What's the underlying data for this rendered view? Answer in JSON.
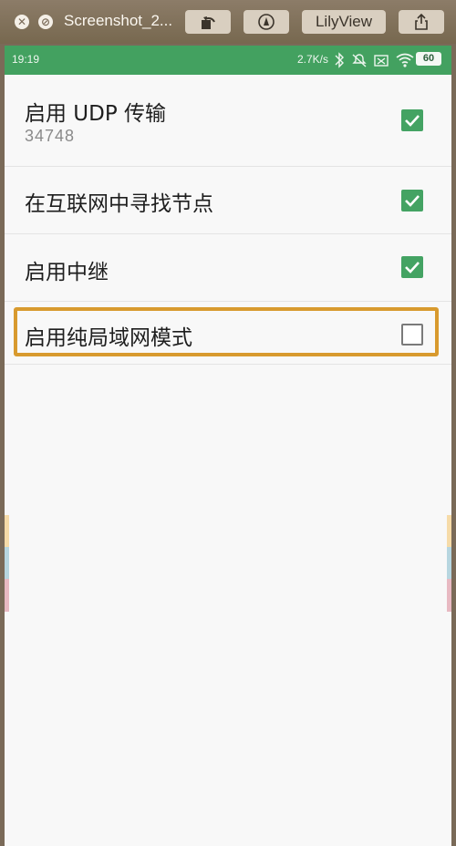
{
  "viewer": {
    "title": "Screenshot_2...",
    "app_button": "LilyView"
  },
  "statusbar": {
    "time": "19:19",
    "net_speed": "2.7K/s",
    "battery": "60"
  },
  "settings": {
    "items": [
      {
        "title": "启用 UDP 传输",
        "subtitle": "34748",
        "checked": true
      },
      {
        "title": "在互联网中寻找节点",
        "checked": true
      },
      {
        "title": "启用中继",
        "checked": true
      },
      {
        "title": "启用纯局域网模式",
        "checked": false
      }
    ]
  },
  "colors": {
    "accent": "#43a160",
    "highlight": "#d89a2e"
  }
}
